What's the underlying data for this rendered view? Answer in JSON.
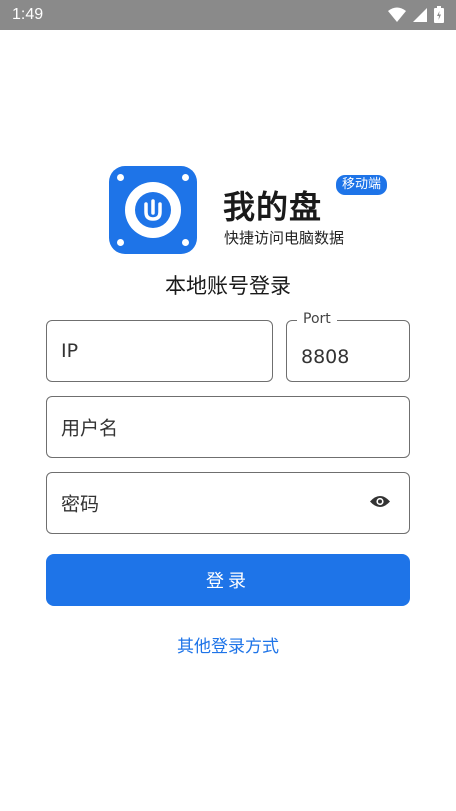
{
  "status_bar": {
    "time": "1:49",
    "icons": [
      "wifi-icon",
      "signal-icon",
      "battery-icon"
    ]
  },
  "brand": {
    "title": "我的盘",
    "badge": "移动端",
    "subtitle": "快捷访问电脑数据",
    "accent_color": "#1e74e8"
  },
  "login": {
    "heading": "本地账号登录",
    "ip_placeholder": "IP",
    "port_label": "Port",
    "port_value": "8808",
    "username_placeholder": "用户名",
    "password_placeholder": "密码",
    "submit_label": "登录",
    "other_methods_link": "其他登录方式"
  }
}
